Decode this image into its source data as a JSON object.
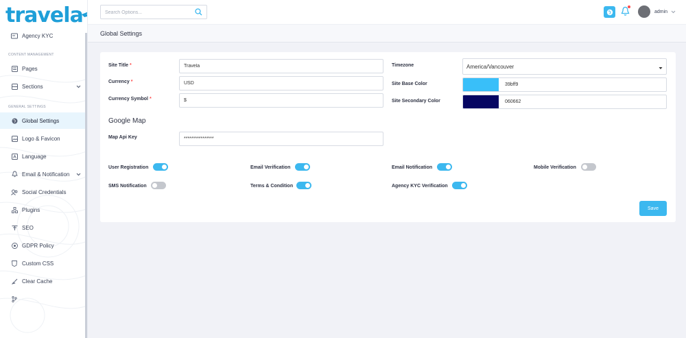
{
  "brand": {
    "logo_text": "travela",
    "accent": "#3cb8ef"
  },
  "search": {
    "placeholder": "Search Options..."
  },
  "header": {
    "username": "admin"
  },
  "sidebar": {
    "sections": {
      "content": "CONTENT MANAGEMENT",
      "general": "GENERAL SETTINGS"
    },
    "items": [
      {
        "label": "Agency KYC",
        "icon": "id-card-icon"
      },
      {
        "label": "Pages",
        "icon": "page-icon"
      },
      {
        "label": "Sections",
        "icon": "sections-icon"
      },
      {
        "label": "Global Settings",
        "icon": "globe-icon"
      },
      {
        "label": "Logo & Favicon",
        "icon": "image-icon"
      },
      {
        "label": "Language",
        "icon": "language-icon"
      },
      {
        "label": "Email & Notification",
        "icon": "bell-icon"
      },
      {
        "label": "Social Credentials",
        "icon": "users-icon"
      },
      {
        "label": "Plugins",
        "icon": "plugin-icon"
      },
      {
        "label": "SEO",
        "icon": "seo-icon"
      },
      {
        "label": "GDPR Policy",
        "icon": "policy-icon"
      },
      {
        "label": "Custom CSS",
        "icon": "code-icon"
      },
      {
        "label": "Clear Cache",
        "icon": "broom-icon"
      },
      {
        "label": "",
        "icon": "branch-icon"
      }
    ]
  },
  "page": {
    "title": "Global Settings"
  },
  "form": {
    "site_title": {
      "label": "Site Title",
      "value": "Travela"
    },
    "currency": {
      "label": "Currency",
      "value": "USD"
    },
    "currency_symbol": {
      "label": "Currency Symbol",
      "value": "$"
    },
    "timezone": {
      "label": "Timezone",
      "value": "America/Vancouver"
    },
    "base_color": {
      "label": "Site Base Color",
      "value": "39bff9",
      "color": "#39bff9"
    },
    "secondary_color": {
      "label": "Site Secondary Color",
      "value": "060662",
      "color": "#060662"
    },
    "google_map_title": "Google Map",
    "map_api_key": {
      "label": "Map Api Key",
      "value": "****************"
    },
    "toggles": {
      "user_registration": {
        "label": "User Registration",
        "on": true
      },
      "email_verification": {
        "label": "Email Verification",
        "on": true
      },
      "email_notification": {
        "label": "Email Notification",
        "on": true
      },
      "mobile_verification": {
        "label": "Mobile Verification",
        "on": false
      },
      "sms_notification": {
        "label": "SMS Notification",
        "on": false
      },
      "terms_condition": {
        "label": "Terms & Condition",
        "on": true
      },
      "agency_kyc": {
        "label": "Agency KYC Verification",
        "on": true
      }
    },
    "save_label": "Save"
  }
}
